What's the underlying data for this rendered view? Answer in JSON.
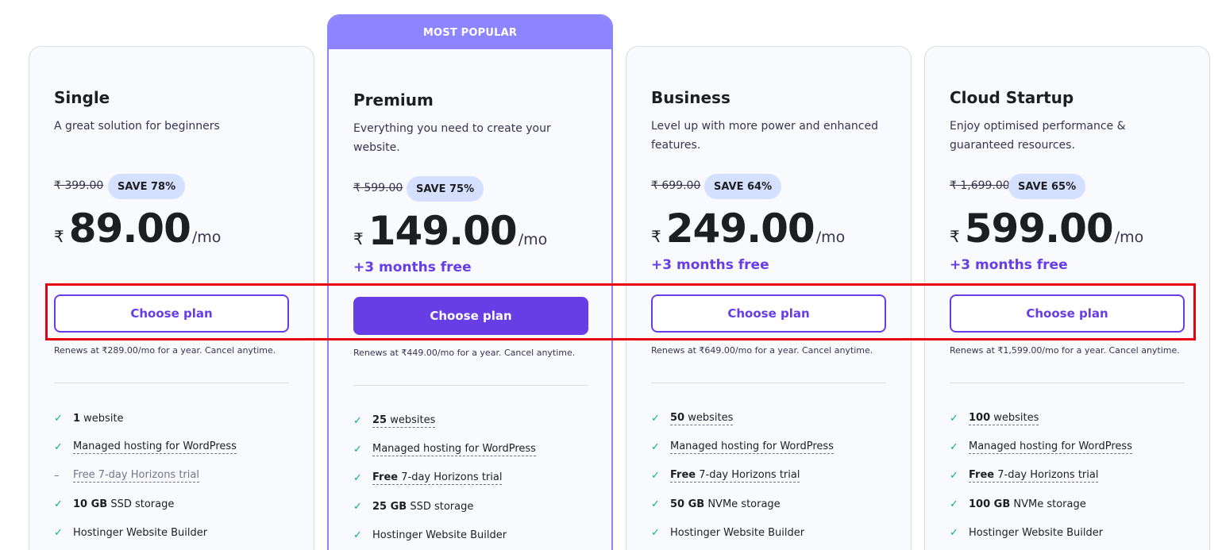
{
  "popular_label": "MOST POPULAR",
  "plans": [
    {
      "title": "Single",
      "description": "A great solution for beginners",
      "old_price": "₹ 399.00",
      "save": "SAVE 78%",
      "currency": "₹",
      "price": "89.00",
      "per": "/mo",
      "bonus": "",
      "cta": "Choose plan",
      "renew": "Renews at ₹289.00/mo for a year. Cancel anytime.",
      "features": [
        {
          "bold": "1",
          "text": " website",
          "mark": "check",
          "dotted": false,
          "muted": false
        },
        {
          "bold": "",
          "text": "Managed hosting for WordPress",
          "mark": "check",
          "dotted": true,
          "muted": false
        },
        {
          "bold": "",
          "text": "Free 7-day Horizons trial",
          "mark": "dash",
          "dotted": true,
          "muted": true
        },
        {
          "bold": "10 GB",
          "text": " SSD storage",
          "mark": "check",
          "dotted": false,
          "muted": false
        },
        {
          "bold": "",
          "text": "Hostinger Website Builder",
          "mark": "check",
          "dotted": false,
          "muted": false
        }
      ]
    },
    {
      "title": "Premium",
      "description": "Everything you need to create your website.",
      "old_price": "₹ 599.00",
      "save": "SAVE 75%",
      "currency": "₹",
      "price": "149.00",
      "per": "/mo",
      "bonus": "+3 months free",
      "cta": "Choose plan",
      "renew": "Renews at ₹449.00/mo for a year. Cancel anytime.",
      "features": [
        {
          "bold": "25",
          "text": " websites",
          "mark": "check",
          "dotted": true,
          "muted": false
        },
        {
          "bold": "",
          "text": "Managed hosting for WordPress",
          "mark": "check",
          "dotted": true,
          "muted": false
        },
        {
          "bold": "Free",
          "text": " 7-day Horizons trial",
          "mark": "check",
          "dotted": true,
          "muted": false
        },
        {
          "bold": "25 GB",
          "text": " SSD storage",
          "mark": "check",
          "dotted": false,
          "muted": false
        },
        {
          "bold": "",
          "text": "Hostinger Website Builder",
          "mark": "check",
          "dotted": false,
          "muted": false
        }
      ]
    },
    {
      "title": "Business",
      "description": "Level up with more power and enhanced features.",
      "old_price": "₹ 699.00",
      "save": "SAVE 64%",
      "currency": "₹",
      "price": "249.00",
      "per": "/mo",
      "bonus": "+3 months free",
      "cta": "Choose plan",
      "renew": "Renews at ₹649.00/mo for a year. Cancel anytime.",
      "features": [
        {
          "bold": "50",
          "text": " websites",
          "mark": "check",
          "dotted": true,
          "muted": false
        },
        {
          "bold": "",
          "text": "Managed hosting for WordPress",
          "mark": "check",
          "dotted": true,
          "muted": false
        },
        {
          "bold": "Free",
          "text": " 7-day Horizons trial",
          "mark": "check",
          "dotted": true,
          "muted": false
        },
        {
          "bold": "50 GB",
          "text": " NVMe storage",
          "mark": "check",
          "dotted": false,
          "muted": false
        },
        {
          "bold": "",
          "text": "Hostinger Website Builder",
          "mark": "check",
          "dotted": false,
          "muted": false
        }
      ]
    },
    {
      "title": "Cloud Startup",
      "description": "Enjoy optimised performance & guaranteed resources.",
      "old_price": "₹ 1,699.00",
      "save": "SAVE 65%",
      "currency": "₹",
      "price": "599.00",
      "per": "/mo",
      "bonus": "+3 months free",
      "cta": "Choose plan",
      "renew": "Renews at ₹1,599.00/mo for a year. Cancel anytime.",
      "features": [
        {
          "bold": "100",
          "text": " websites",
          "mark": "check",
          "dotted": true,
          "muted": false
        },
        {
          "bold": "",
          "text": "Managed hosting for WordPress",
          "mark": "check",
          "dotted": true,
          "muted": false
        },
        {
          "bold": "Free",
          "text": " 7-day Horizons trial",
          "mark": "check",
          "dotted": true,
          "muted": false
        },
        {
          "bold": "100 GB",
          "text": " NVMe storage",
          "mark": "check",
          "dotted": false,
          "muted": false
        },
        {
          "bold": "",
          "text": "Hostinger Website Builder",
          "mark": "check",
          "dotted": false,
          "muted": false
        }
      ]
    }
  ],
  "colors": {
    "accent": "#673de6",
    "popular": "#8c85ff",
    "save_badge": "#d5dfff",
    "check": "#00b090",
    "highlight": "#e8000b"
  },
  "icons": {
    "check": "check-icon",
    "dash": "dash-icon"
  }
}
